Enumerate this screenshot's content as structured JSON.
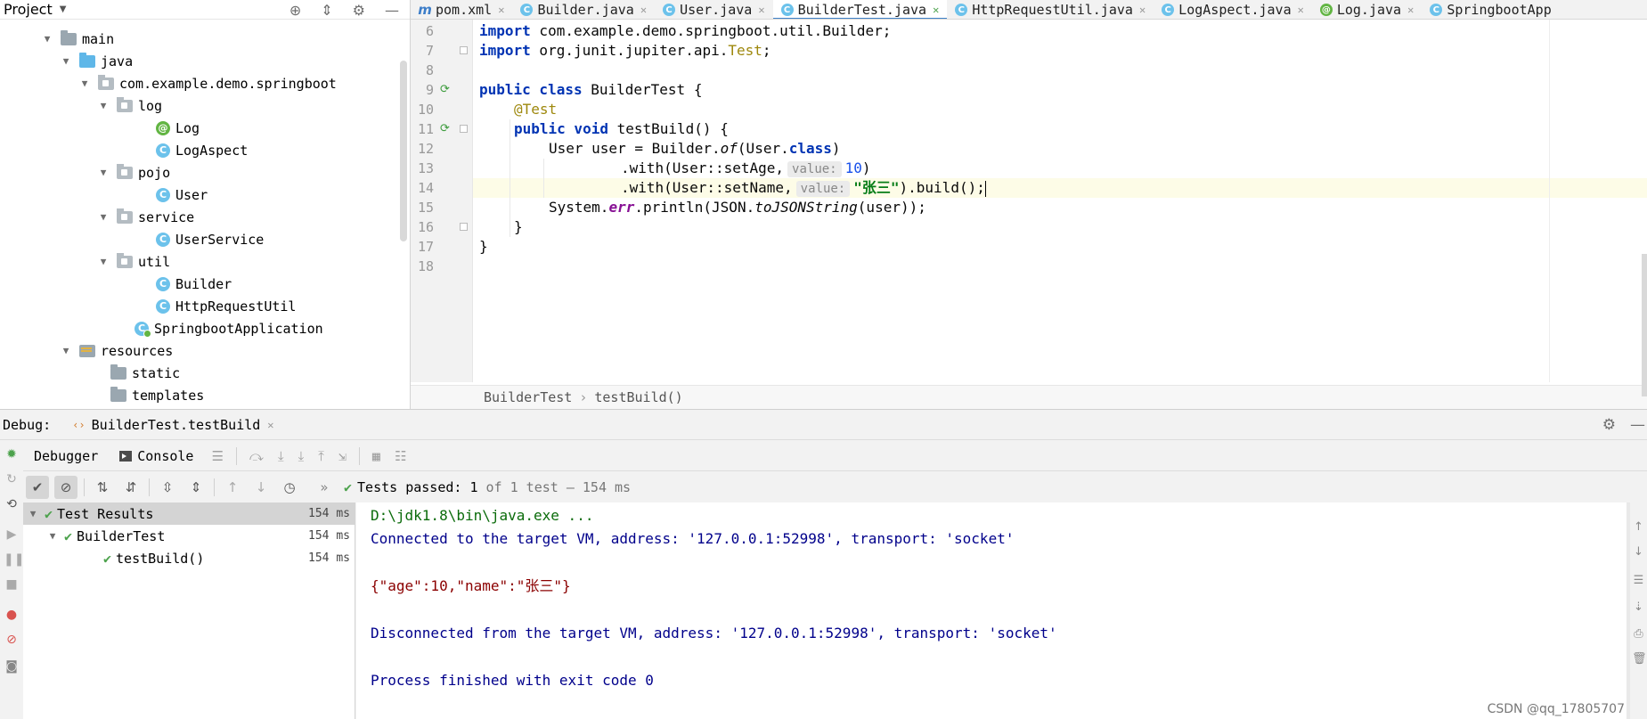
{
  "project_panel": {
    "title": "Project",
    "tree": [
      {
        "label": "main",
        "type": "folder",
        "expanded": true
      },
      {
        "label": "java",
        "type": "source-folder",
        "expanded": true
      },
      {
        "label": "com.example.demo.springboot",
        "type": "package",
        "expanded": true
      },
      {
        "label": "log",
        "type": "package",
        "expanded": true
      },
      {
        "label": "Log",
        "type": "annotation"
      },
      {
        "label": "LogAspect",
        "type": "class"
      },
      {
        "label": "pojo",
        "type": "package",
        "expanded": true
      },
      {
        "label": "User",
        "type": "class"
      },
      {
        "label": "service",
        "type": "package",
        "expanded": true
      },
      {
        "label": "UserService",
        "type": "class"
      },
      {
        "label": "util",
        "type": "package",
        "expanded": true
      },
      {
        "label": "Builder",
        "type": "class"
      },
      {
        "label": "HttpRequestUtil",
        "type": "class"
      },
      {
        "label": "SpringbootApplication",
        "type": "spring-class"
      },
      {
        "label": "resources",
        "type": "resources-folder",
        "expanded": true
      },
      {
        "label": "static",
        "type": "folder"
      },
      {
        "label": "templates",
        "type": "folder"
      }
    ]
  },
  "editor": {
    "tabs": [
      {
        "label": "pom.xml",
        "icon": "maven-icon",
        "active": false
      },
      {
        "label": "Builder.java",
        "icon": "class-icon",
        "active": false
      },
      {
        "label": "User.java",
        "icon": "class-icon",
        "active": false
      },
      {
        "label": "BuilderTest.java",
        "icon": "class-icon",
        "active": true
      },
      {
        "label": "HttpRequestUtil.java",
        "icon": "class-icon",
        "active": false
      },
      {
        "label": "LogAspect.java",
        "icon": "class-icon",
        "active": false
      },
      {
        "label": "Log.java",
        "icon": "annotation-icon",
        "active": false
      },
      {
        "label": "SpringbootApp",
        "icon": "spring-icon",
        "active": false
      }
    ],
    "line_numbers": [
      "6",
      "7",
      "8",
      "9",
      "10",
      "11",
      "12",
      "13",
      "14",
      "15",
      "16",
      "17",
      "18"
    ],
    "code": {
      "l6_kw": "import",
      "l6_rest": " com.example.demo.springboot.util.Builder;",
      "l7_kw": "import",
      "l7_pre": " org.junit.jupiter.api.",
      "l7_ann": "Test",
      "l7_post": ";",
      "l9_kw": "public class",
      "l9_rest": " BuilderTest {",
      "l10_ann": "@Test",
      "l11_kw": "public void",
      "l11_rest": " testBuild() {",
      "l12_pre": "User user = Builder.",
      "l12_of": "of",
      "l12_mid": "(User.",
      "l12_kw": "class",
      "l12_post": ")",
      "l13_pre": ".with(User::setAge,",
      "l13_hint": "value:",
      "l13_num": "10",
      "l13_post": ")",
      "l14_pre": ".with(User::setName,",
      "l14_hint": "value:",
      "l14_str": "\"张三\"",
      "l14_post": ").build();",
      "l15_pre": "System.",
      "l15_field": "err",
      "l15_mid": ".println(JSON.",
      "l15_ital": "toJSONString",
      "l15_post": "(user));",
      "l16": "}",
      "l17": "}"
    },
    "breadcrumb": [
      "BuilderTest",
      "testBuild()"
    ]
  },
  "debug": {
    "label": "Debug:",
    "session": "BuilderTest.testBuild",
    "subtabs": [
      "Debugger",
      "Console"
    ],
    "tests_status": {
      "prefix": "Tests passed:",
      "count": "1",
      "suffix": "of 1 test – 154 ms"
    },
    "test_tree": [
      {
        "label": "Test Results",
        "time": "154 ms",
        "selected": true
      },
      {
        "label": "BuilderTest",
        "time": "154 ms",
        "selected": false
      },
      {
        "label": "testBuild()",
        "time": "154 ms",
        "selected": false
      }
    ],
    "console": [
      "D:\\jdk1.8\\bin\\java.exe ...",
      "Connected to the target VM, address: '127.0.0.1:52998', transport: 'socket'",
      "{\"age\":10,\"name\":\"张三\"}",
      "Disconnected from the target VM, address: '127.0.0.1:52998', transport: 'socket'",
      "Process finished with exit code 0"
    ]
  },
  "watermark": "CSDN @qq_17805707"
}
